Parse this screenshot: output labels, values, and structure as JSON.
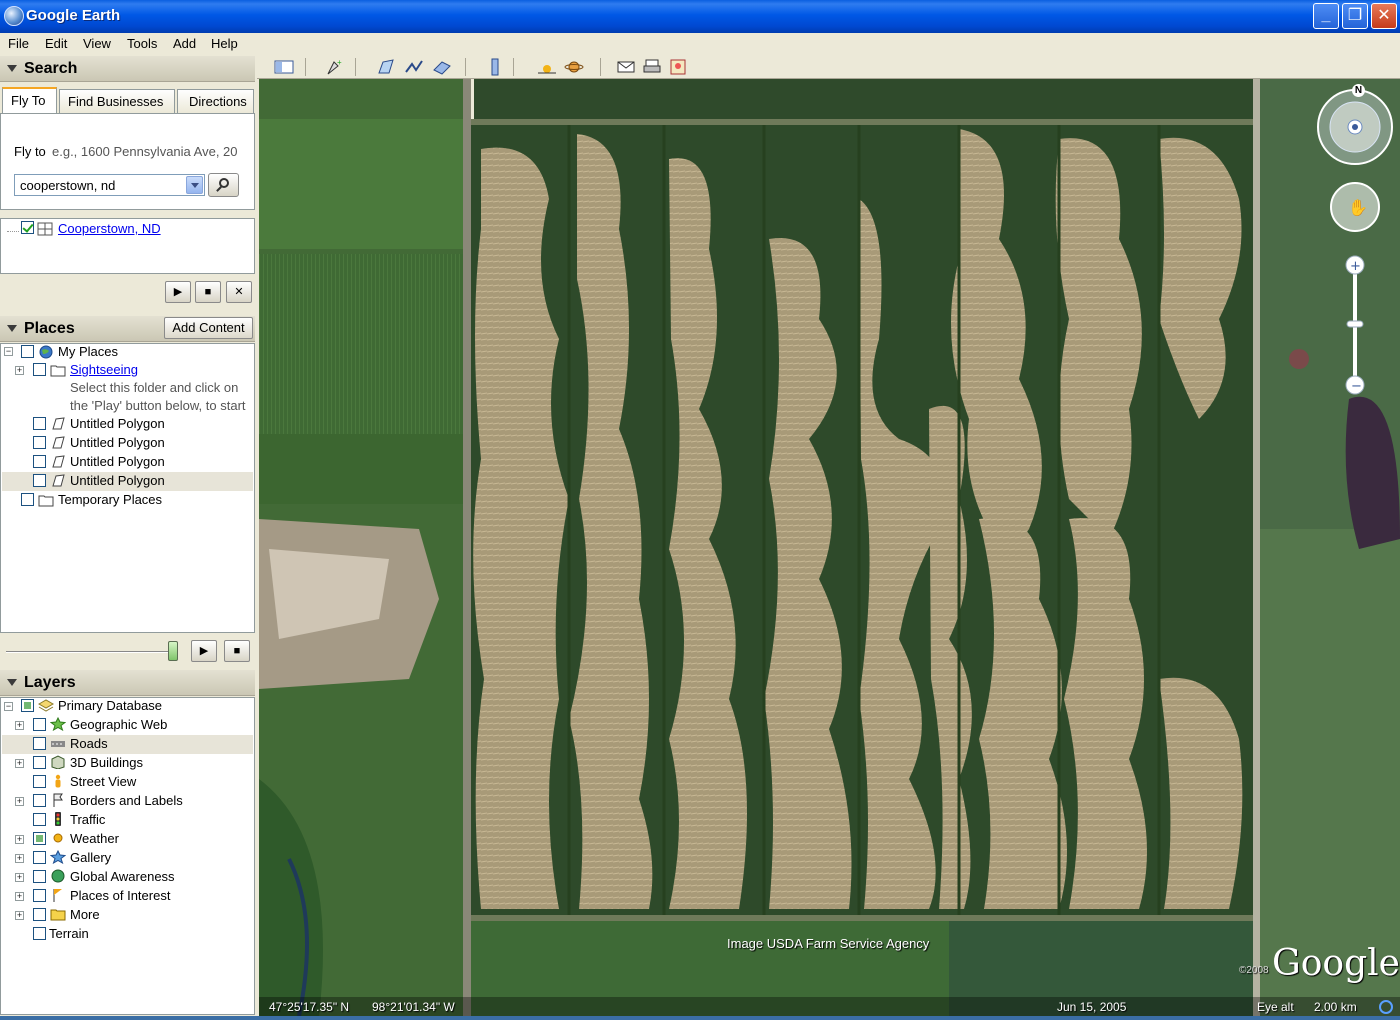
{
  "window": {
    "title": "Google Earth"
  },
  "menu": [
    "File",
    "Edit",
    "View",
    "Tools",
    "Add",
    "Help"
  ],
  "search": {
    "header": "Search",
    "tabs": [
      "Fly To",
      "Find Businesses",
      "Directions"
    ],
    "fly_to_label": "Fly to",
    "fly_to_placeholder": "e.g., 1600 Pennsylvania Ave, 20",
    "query": "cooperstown, nd",
    "result": "Cooperstown, ND"
  },
  "places": {
    "header": "Places",
    "add_content": "Add Content",
    "items": [
      {
        "label": "My Places"
      },
      {
        "label": "Sightseeing"
      },
      {
        "label": "Select this folder and click on"
      },
      {
        "label": "the 'Play' button below, to start"
      },
      {
        "label": "Untitled Polygon"
      },
      {
        "label": "Untitled Polygon"
      },
      {
        "label": "Untitled Polygon"
      },
      {
        "label": "Untitled Polygon"
      },
      {
        "label": "Temporary Places"
      }
    ]
  },
  "layers": {
    "header": "Layers",
    "items": [
      {
        "label": "Primary Database"
      },
      {
        "label": "Geographic Web"
      },
      {
        "label": "Roads"
      },
      {
        "label": "3D Buildings"
      },
      {
        "label": "Street View"
      },
      {
        "label": "Borders and Labels"
      },
      {
        "label": "Traffic"
      },
      {
        "label": "Weather"
      },
      {
        "label": "Gallery"
      },
      {
        "label": "Global Awareness"
      },
      {
        "label": "Places of Interest"
      },
      {
        "label": "More"
      },
      {
        "label": "Terrain"
      }
    ]
  },
  "map": {
    "imagery_credit": "Image USDA Farm Service Agency",
    "copyright": "©2008",
    "logo": "Google",
    "lat": "47°25'17.35\" N",
    "lon": "98°21'01.34\" W",
    "date": "Jun 15, 2005",
    "eye_alt_label": "Eye alt",
    "eye_alt_value": "2.00 km",
    "north_label": "N"
  },
  "colors": {
    "titlebar": "#0058e6",
    "panel": "#ece9d8",
    "link": "#0000ee"
  }
}
